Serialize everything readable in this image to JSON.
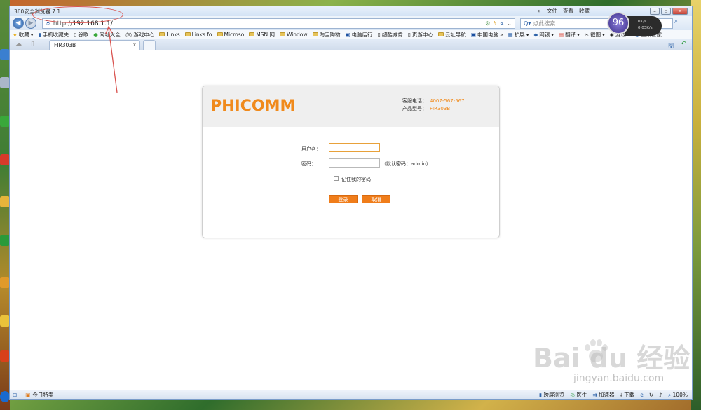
{
  "browser": {
    "title": "360安全浏览器 7.1",
    "menu": [
      "»",
      "文件",
      "查看",
      "收藏"
    ],
    "address": {
      "prefix": "http://",
      "host": "192.168.1.1/"
    },
    "search_placeholder": "点此搜索",
    "speed": {
      "score": "96",
      "unit": "+",
      "down": "0K/s",
      "up": "0.03K/s"
    }
  },
  "favorites": [
    {
      "label": "收藏",
      "icon": "star-icon"
    },
    {
      "label": "手机收藏夹",
      "icon": "phone-icon"
    },
    {
      "label": "谷歌",
      "icon": "page-icon"
    },
    {
      "label": "网址大全",
      "icon": "green-circle-icon"
    },
    {
      "label": "游戏中心",
      "icon": "gamepad-icon"
    },
    {
      "label": "Links",
      "icon": "folder-icon"
    },
    {
      "label": "Links fo",
      "icon": "folder-icon"
    },
    {
      "label": "Microso",
      "icon": "folder-icon"
    },
    {
      "label": "MSN 网",
      "icon": "folder-icon"
    },
    {
      "label": "Window",
      "icon": "folder-icon"
    },
    {
      "label": "淘宝购物",
      "icon": "folder-icon"
    },
    {
      "label": "电脑店行",
      "icon": "blue-box-icon"
    },
    {
      "label": "超酷减肯",
      "icon": "page-icon"
    },
    {
      "label": "页游中心",
      "icon": "page-icon"
    },
    {
      "label": "云址导航",
      "icon": "folder-icon"
    },
    {
      "label": "中国电脑",
      "icon": "blue-box-icon"
    }
  ],
  "tools": [
    "扩展",
    "网银",
    "翻译",
    "截图",
    "游戏",
    "登录管家"
  ],
  "tab": {
    "label": "FIR303B",
    "close": "x"
  },
  "page": {
    "logo": "PHICOMM",
    "hotline_label": "客服电话：",
    "hotline": "4007-567-567",
    "model_label": "产品型号：",
    "model": "FIR303B",
    "username_label": "用户名：",
    "password_label": "密码：",
    "password_hint": "（默认密码：admin）",
    "remember_label": "记住我的密码",
    "login_button": "登录",
    "cancel_button": "取消"
  },
  "status": {
    "left": "今日特卖",
    "right": [
      "跨屏浏览",
      "医生",
      "加速器",
      "下载",
      "100%"
    ]
  },
  "watermark": {
    "text": "Bai du 经验",
    "url": "jingyan.baidu.com"
  }
}
